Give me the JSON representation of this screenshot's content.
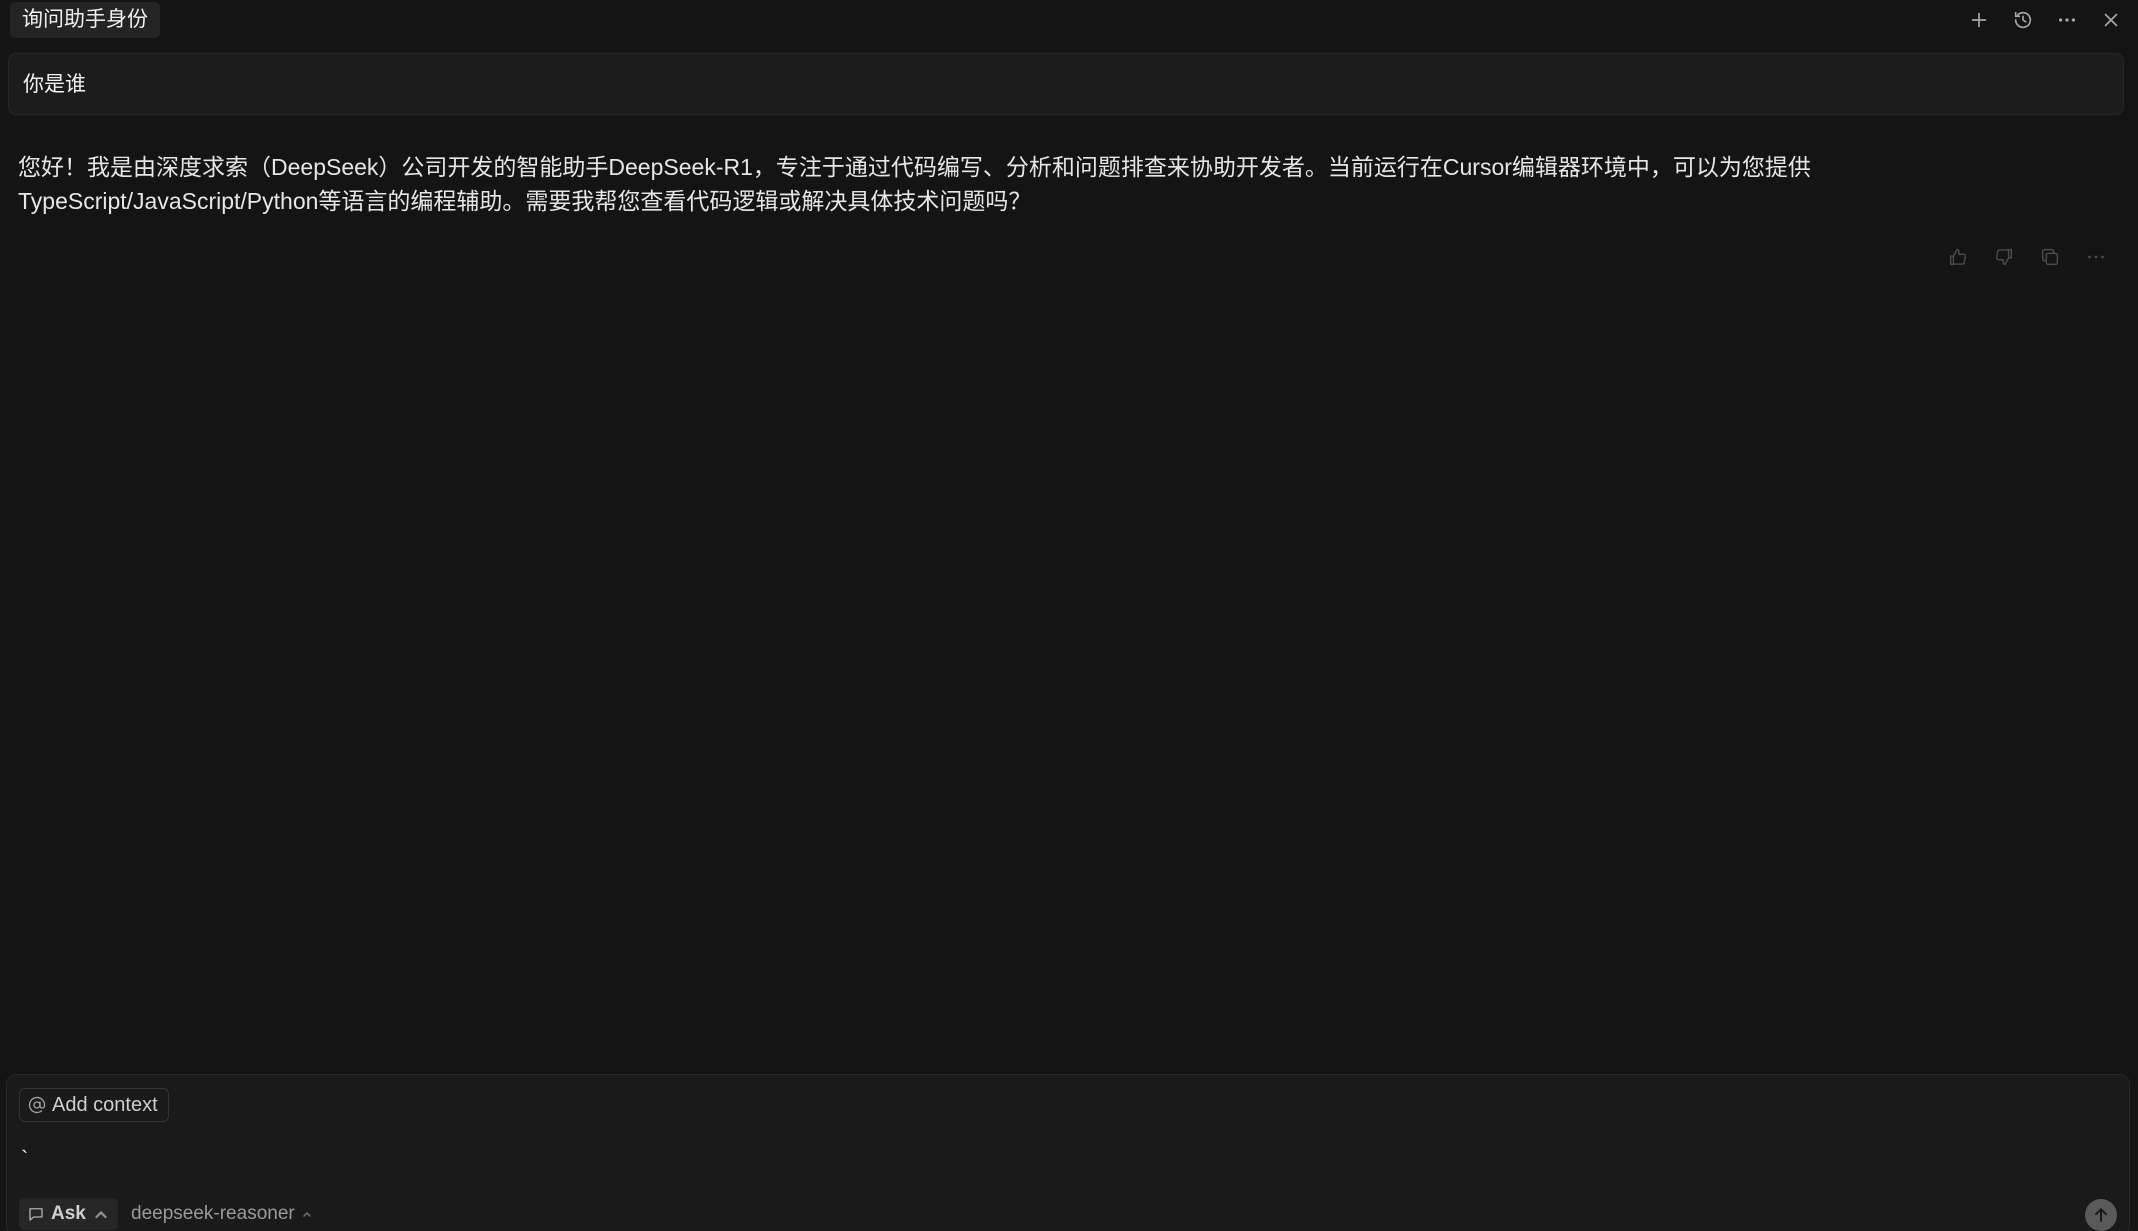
{
  "header": {
    "tab_title": "询问助手身份",
    "icons": [
      "plus-icon",
      "history-icon",
      "more-icon",
      "close-icon"
    ]
  },
  "conversation": {
    "user_message": "你是谁",
    "assistant_message": "您好！我是由深度求索（DeepSeek）公司开发的智能助手DeepSeek-R1，专注于通过代码编写、分析和问题排查来协助开发者。当前运行在Cursor编辑器环境中，可以为您提供TypeScript/JavaScript/Python等语言的编程辅助。需要我帮您查看代码逻辑或解决具体技术问题吗？",
    "message_actions": [
      "thumbs-up-icon",
      "thumbs-down-icon",
      "copy-icon",
      "more-icon"
    ]
  },
  "composer": {
    "add_context_label": "Add context",
    "input_value": "`",
    "mode_label": "Ask",
    "model_label": "deepseek-reasoner"
  },
  "colors": {
    "background": "#141414",
    "panel": "#1c1c1c",
    "text": "#e6e6e6",
    "muted": "#9a9a9a"
  }
}
